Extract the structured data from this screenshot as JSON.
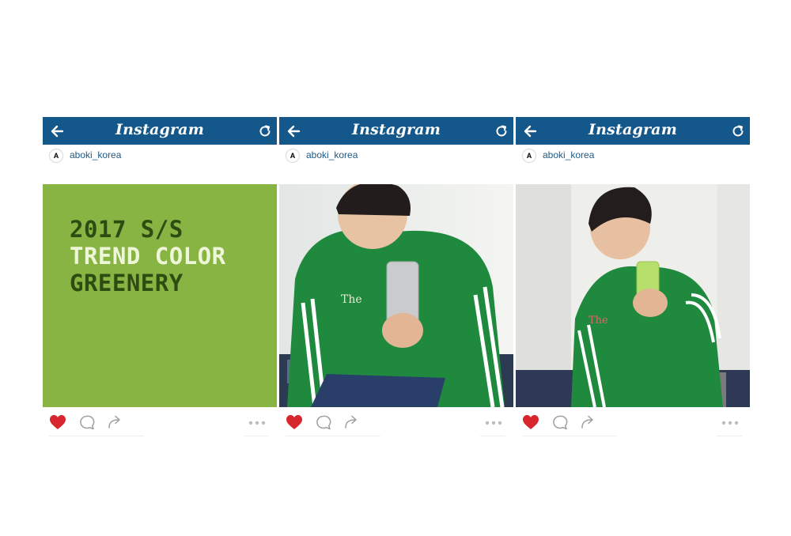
{
  "app": {
    "title": "Instagram"
  },
  "colors": {
    "topbar": "#14578a",
    "greenery": "#88b443",
    "heart": "#d8262e",
    "username": "#1f5a86"
  },
  "icons": {
    "back": "arrow-left-icon",
    "refresh": "refresh-icon",
    "like": "heart-icon",
    "comment": "comment-icon",
    "share": "share-icon",
    "more": "more-dots-icon"
  },
  "posts": [
    {
      "username": "aboki_korea",
      "avatar_letter": "A",
      "liked": true,
      "headline": {
        "line1": "2017 S/S",
        "line2": "TREND COLOR",
        "line3": "GREENERY"
      }
    },
    {
      "username": "aboki_korea",
      "avatar_letter": "A",
      "liked": true
    },
    {
      "username": "aboki_korea",
      "avatar_letter": "A",
      "liked": true
    }
  ]
}
